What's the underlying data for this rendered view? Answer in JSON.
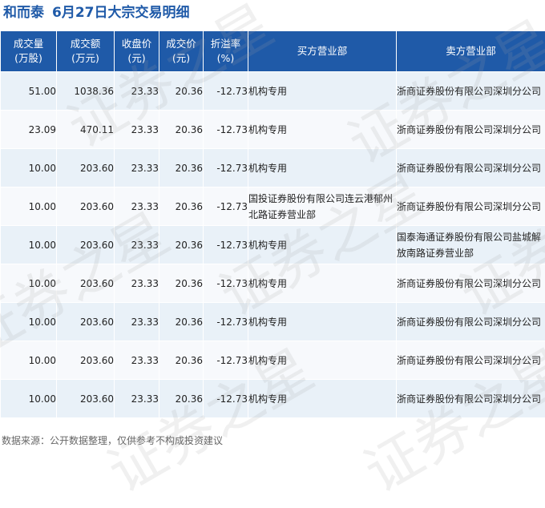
{
  "title": {
    "stock_name": "和而泰",
    "subtitle": "6月27日大宗交易明细"
  },
  "table": {
    "headers": [
      {
        "line1": "成交量",
        "line2": "(万股)"
      },
      {
        "line1": "成交额",
        "line2": "(万元)"
      },
      {
        "line1": "收盘价",
        "line2": "(元)"
      },
      {
        "line1": "成交价",
        "line2": "(元)"
      },
      {
        "line1": "折溢率",
        "line2": "(%)"
      },
      {
        "line1": "买方营业部",
        "line2": ""
      },
      {
        "line1": "卖方营业部",
        "line2": ""
      }
    ],
    "rows": [
      {
        "volume": "51.00",
        "amount": "1038.36",
        "close": "23.33",
        "price": "20.36",
        "premium": "-12.73",
        "buyer": "机构专用",
        "seller": "浙商证券股份有限公司深圳分公司"
      },
      {
        "volume": "23.09",
        "amount": "470.11",
        "close": "23.33",
        "price": "20.36",
        "premium": "-12.73",
        "buyer": "机构专用",
        "seller": "浙商证券股份有限公司深圳分公司"
      },
      {
        "volume": "10.00",
        "amount": "203.60",
        "close": "23.33",
        "price": "20.36",
        "premium": "-12.73",
        "buyer": "机构专用",
        "seller": "浙商证券股份有限公司深圳分公司"
      },
      {
        "volume": "10.00",
        "amount": "203.60",
        "close": "23.33",
        "price": "20.36",
        "premium": "-12.73",
        "buyer": "国投证券股份有限公司连云港郁州北路证券营业部",
        "seller": "浙商证券股份有限公司深圳分公司"
      },
      {
        "volume": "10.00",
        "amount": "203.60",
        "close": "23.33",
        "price": "20.36",
        "premium": "-12.73",
        "buyer": "机构专用",
        "seller": "国泰海通证券股份有限公司盐城解放南路证券营业部"
      },
      {
        "volume": "10.00",
        "amount": "203.60",
        "close": "23.33",
        "price": "20.36",
        "premium": "-12.73",
        "buyer": "机构专用",
        "seller": "浙商证券股份有限公司深圳分公司"
      },
      {
        "volume": "10.00",
        "amount": "203.60",
        "close": "23.33",
        "price": "20.36",
        "premium": "-12.73",
        "buyer": "机构专用",
        "seller": "浙商证券股份有限公司深圳分公司"
      },
      {
        "volume": "10.00",
        "amount": "203.60",
        "close": "23.33",
        "price": "20.36",
        "premium": "-12.73",
        "buyer": "机构专用",
        "seller": "浙商证券股份有限公司深圳分公司"
      },
      {
        "volume": "10.00",
        "amount": "203.60",
        "close": "23.33",
        "price": "20.36",
        "premium": "-12.73",
        "buyer": "机构专用",
        "seller": "浙商证券股份有限公司深圳分公司"
      }
    ]
  },
  "watermark": "证券之星",
  "source": "数据来源：公开数据整理，仅供参考不构成投资建议",
  "colors": {
    "header_bg": "#1f5aa8",
    "title": "#1f5aa8",
    "row_odd": "#e9f1f8",
    "row_even": "#f7f9fc",
    "negative_pct": "#1a9a3a"
  }
}
